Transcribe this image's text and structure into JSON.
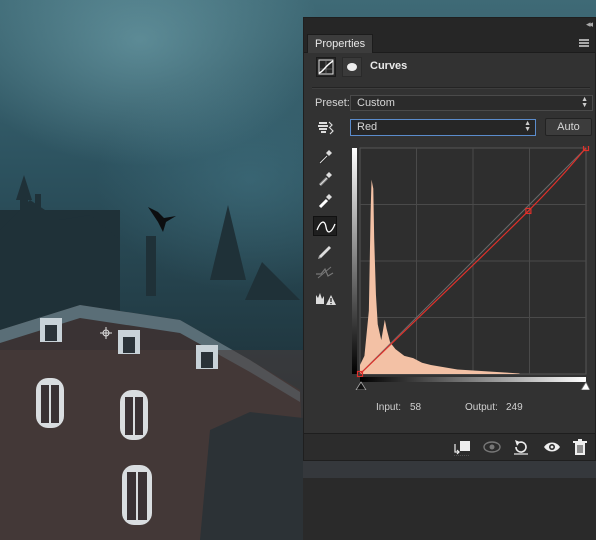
{
  "panel": {
    "tab_label": "Properties",
    "header_title": "Curves",
    "preset_label": "Preset:",
    "preset_value": "Custom",
    "channel_value": "Red",
    "auto_label": "Auto",
    "input_label": "Input:",
    "input_value": "58",
    "output_label": "Output:",
    "output_value": "249"
  },
  "tools": [
    "hand-target-icon",
    "black-eyedropper-icon",
    "gray-eyedropper-icon",
    "white-eyedropper-icon",
    "curve-point-icon",
    "pencil-icon",
    "smooth-icon",
    "clipping-warning-icon"
  ],
  "bottom_icons": [
    "clip-to-layer-icon",
    "view-previous-icon",
    "reset-icon",
    "visibility-eye-icon",
    "trash-icon"
  ],
  "colors": {
    "panel_bg": "#323232",
    "curve_red": "#e0302a",
    "histogram_fill": "#f3c1a5",
    "active_border": "#5b8ccc"
  },
  "curve": {
    "channel": "Red",
    "points": [
      [
        0,
        0
      ],
      [
        190,
        184
      ],
      [
        255,
        255
      ]
    ]
  }
}
